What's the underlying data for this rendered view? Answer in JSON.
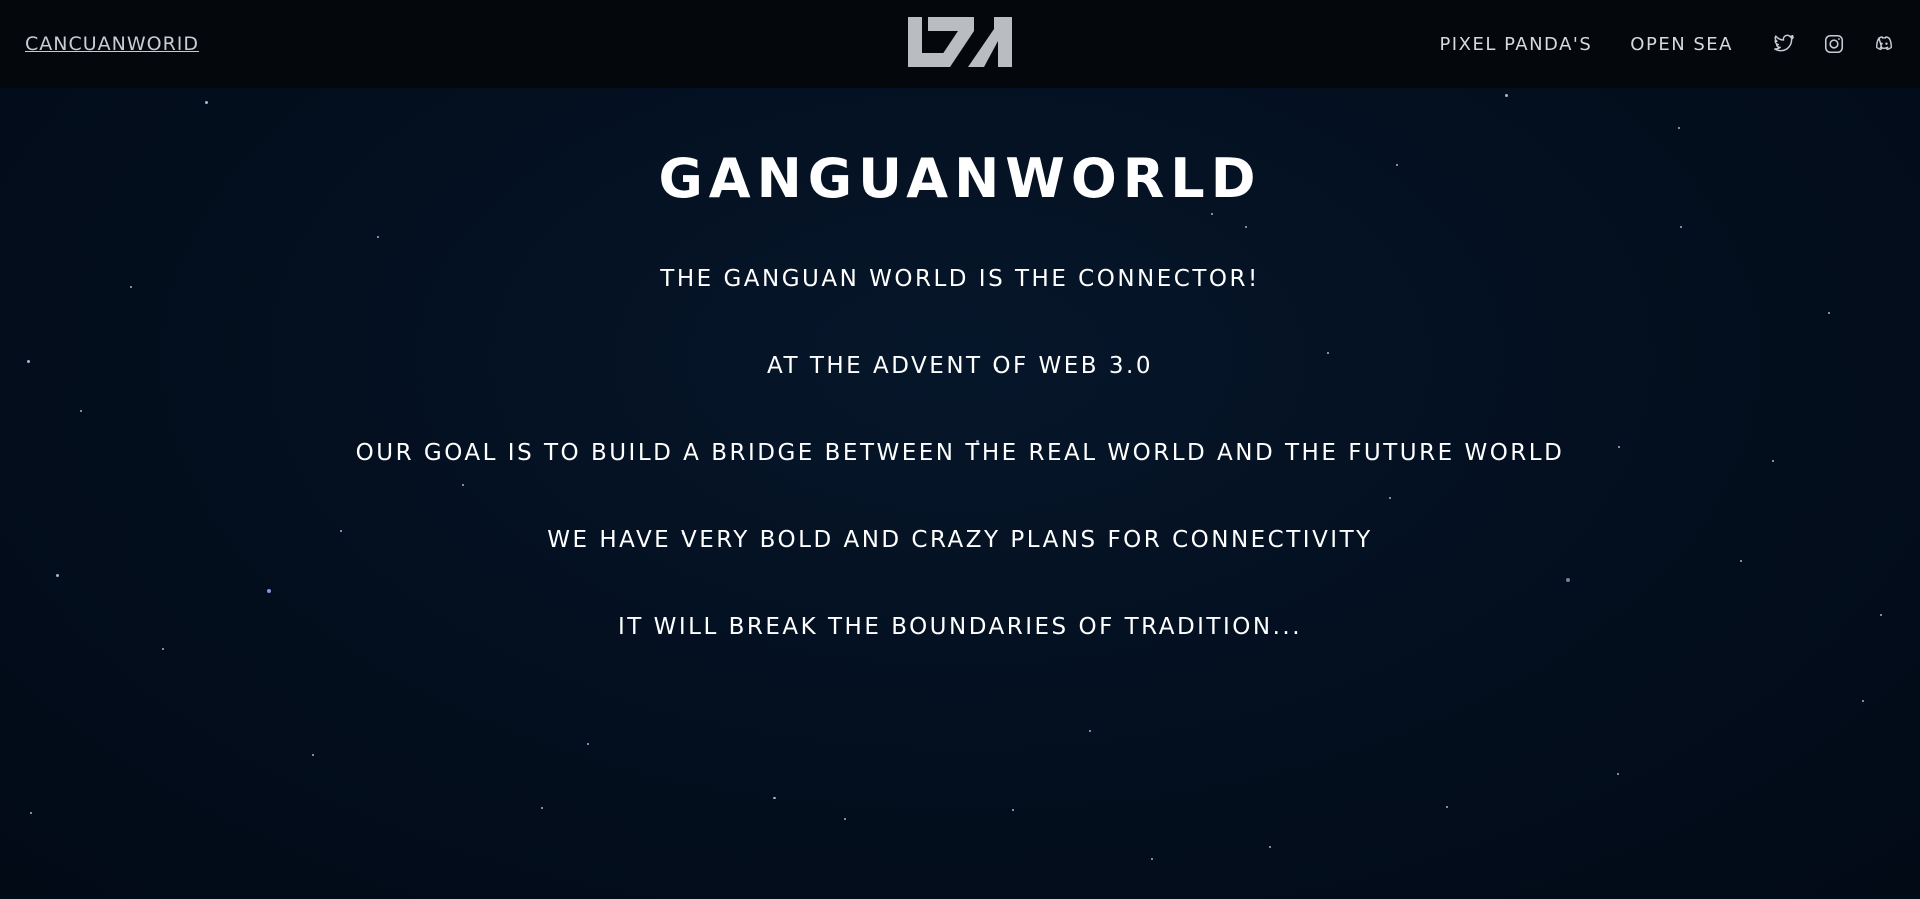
{
  "nav": {
    "brand_label": "CANCUANWORID",
    "links": [
      "PIXEL PANDA'S",
      "OPEN SEA"
    ],
    "social_icons": [
      "twitter-icon",
      "instagram-icon",
      "discord-icon"
    ]
  },
  "hero": {
    "title": "GANGUANWORLD",
    "lines": [
      "THE GANGUAN WORLD IS THE CONNECTOR!",
      "AT THE ADVENT OF WEB 3.0",
      "OUR GOAL IS TO BUILD A BRIDGE BETWEEN THE REAL WORLD AND THE FUTURE WORLD",
      "WE HAVE VERY BOLD AND CRAZY PLANS FOR CONNECTIVITY",
      "IT WILL BREAK THE BOUNDARIES OF TRADITION..."
    ]
  },
  "colors": {
    "background": "#020f1f",
    "navbar": "#04070c",
    "logo": "#b9bcc1",
    "text": "#ffffff"
  }
}
